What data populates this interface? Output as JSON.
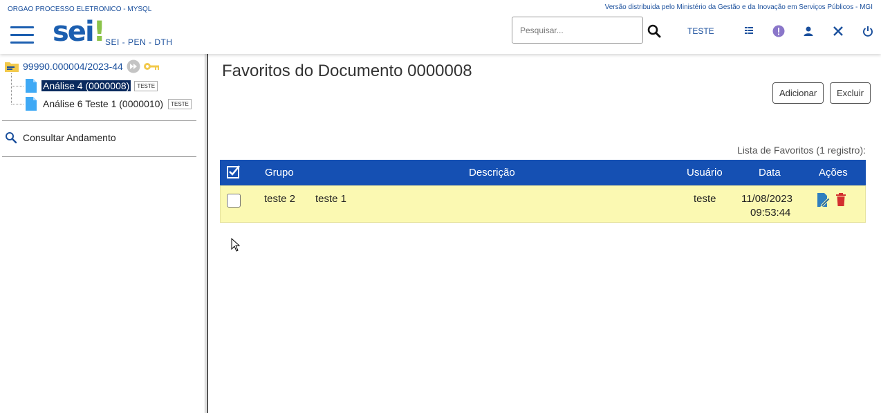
{
  "header": {
    "org": "ORGAO PROCESSO ELETRONICO - MYSQL",
    "version_note": "Versão distribuida pelo Ministério da Gestão e da Inovação em Serviços Públicos - MGI",
    "logo_main": "sei",
    "logo_bang": "!",
    "subtitle": "SEI - PEN - DTH",
    "search_placeholder": "Pesquisar...",
    "user": "TESTE"
  },
  "tree": {
    "process_number": "99990.000004/2023-44",
    "documents": [
      {
        "label": "Análise 4 (0000008)",
        "tag": "TESTE",
        "selected": true
      },
      {
        "label": "Análise 6 Teste 1 (0000010)",
        "tag": "TESTE",
        "selected": false
      }
    ],
    "consultar": "Consultar Andamento"
  },
  "main": {
    "title": "Favoritos do Documento 0000008",
    "btn_add": "Adicionar",
    "btn_delete": "Excluir",
    "caption": "Lista de Favoritos (1 registro):",
    "columns": {
      "grupo": "Grupo",
      "descricao": "Descrição",
      "usuario": "Usuário",
      "data": "Data",
      "acoes": "Ações"
    },
    "rows": [
      {
        "grupo": "teste 2",
        "descricao": "teste 1",
        "usuario": "teste",
        "data": "11/08/2023",
        "hora": "09:53:44"
      }
    ]
  },
  "colors": {
    "accent": "#1550b3",
    "row_highlight": "#fbf9b2",
    "folder": "#f2c94c",
    "delete": "#d32f2f"
  }
}
